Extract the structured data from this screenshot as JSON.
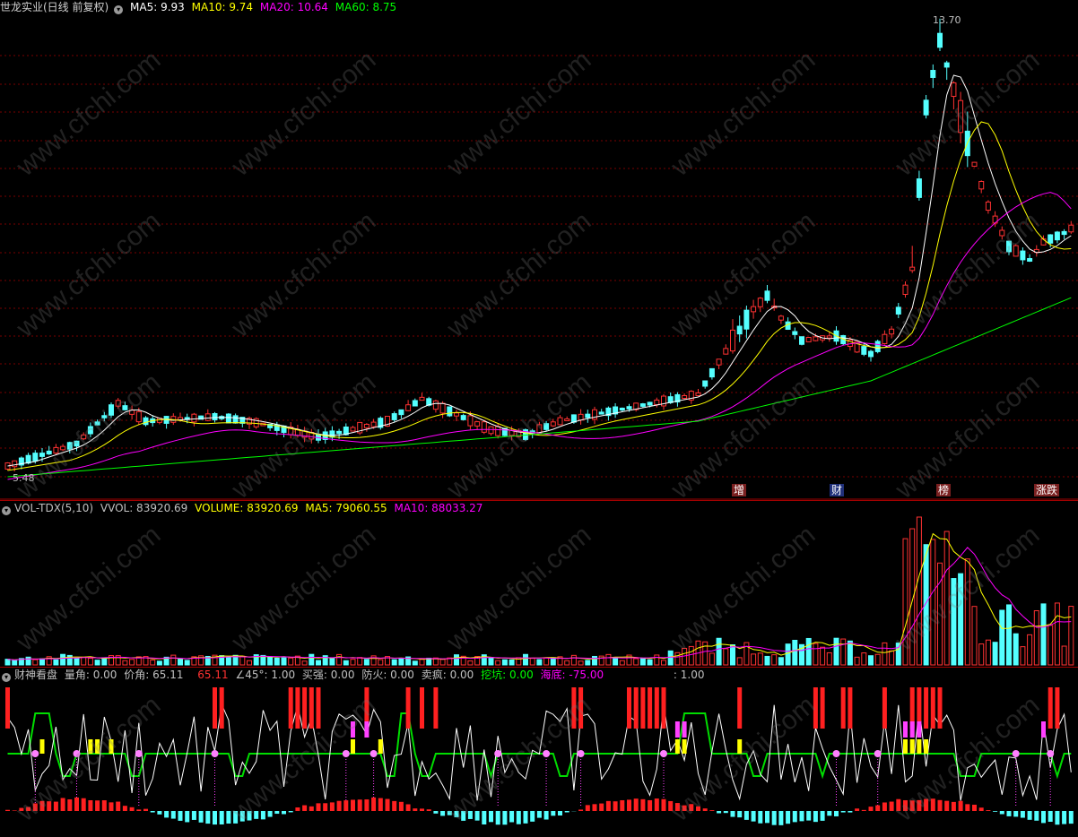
{
  "main": {
    "title": "世龙实业(日线 前复权)",
    "ma5_label": "MA5: 9.93",
    "ma10_label": "MA10: 9.74",
    "ma20_label": "MA20: 10.64",
    "ma60_label": "MA60: 8.75",
    "high_label": "13.70",
    "low_label": "5.48",
    "markers": [
      "增",
      "财",
      "榜",
      "涨跌"
    ]
  },
  "volume": {
    "title": "VOL-TDX(5,10)",
    "vvol_label": "VVOL: 83920.69",
    "volume_label": "VOLUME: 83920.69",
    "ma5_label": "MA5: 79060.55",
    "ma10_label": "MA10: 88033.27"
  },
  "indicator": {
    "title": "财神看盘",
    "liangjiao": "量角: 0.00",
    "jiajiao": "价角: 65.11",
    "val_red": "65.11",
    "angle45": "∠45°: 1.00",
    "shiqiang": "买强: 0.00",
    "fanghuo": "防火: 0.00",
    "maifeng": "卖疯: 0.00",
    "wakeng": "挖坑: 0.00",
    "haidi": "海底: -75.00",
    "extra": ": 1.00"
  },
  "watermark": "www.cfchi.com",
  "colors": {
    "up": "#ff3232",
    "down": "#54ffff",
    "ma5": "#ffffff",
    "ma10": "#ffff00",
    "ma20": "#ff00ff",
    "ma60": "#00ff00"
  }
}
